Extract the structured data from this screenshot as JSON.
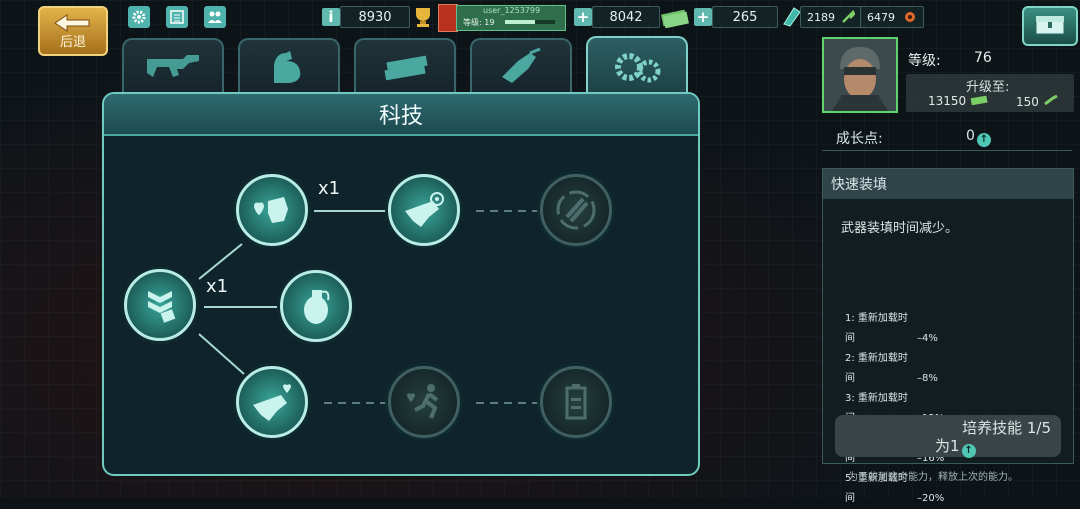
{
  "topbar": {
    "back_label": "后退",
    "trophies": "8930",
    "username": "user_1253799",
    "level_label": "等级: 19",
    "level_progress": 0.6,
    "cash": "8042",
    "gems": "265",
    "ammo_parts": "2189",
    "scrap": "6479"
  },
  "tabs": [
    "rifle-icon",
    "muscle-icon",
    "cash-stack-icon",
    "drill-icon",
    "gears-icon"
  ],
  "panel": {
    "title": "科技",
    "multiplier_top": "x1",
    "multiplier_left": "x1"
  },
  "hero": {
    "level_label": "等级:",
    "level_value": "76",
    "upgrade_label": "升级至:",
    "upgrade_cash": "13150",
    "upgrade_parts": "150",
    "growth_label": "成长点:",
    "growth_value": "0"
  },
  "skill": {
    "name": "快速装填",
    "description": "武器装填时间减少。",
    "levels": [
      {
        "n": "1: 重新加载时间",
        "v": "–4%"
      },
      {
        "n": "2: 重新加载时间",
        "v": "–8%"
      },
      {
        "n": "3: 重新加载时间",
        "v": "–12%"
      },
      {
        "n": "4: 重新加载时间",
        "v": "–16%"
      },
      {
        "n": "5: 重新加载时间",
        "v": "–20%"
      }
    ],
    "train_label": "培养技能 1/5",
    "train_cost": "为1",
    "footnote": "为了收到这个能力，释放上次的能力。"
  },
  "colors": {
    "accent": "#6fcac0",
    "node_active": "#3aa69a",
    "gold": "#e2b44a"
  }
}
